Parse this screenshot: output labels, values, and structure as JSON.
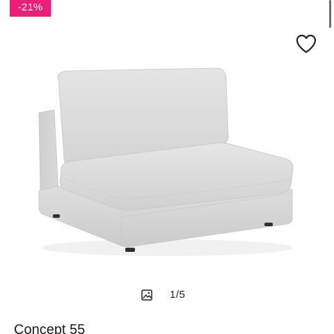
{
  "badge": {
    "discount_label": "-21%",
    "color": "#ec1e78"
  },
  "favorite": {
    "icon": "heart-outline-icon"
  },
  "product_image": {
    "subject": "light grey armless sofa module with back cushion",
    "upholstery_color": "#dcdcdc"
  },
  "gallery": {
    "icon": "image-gallery-icon",
    "counter": "1/5"
  },
  "product": {
    "title": "Concept 55"
  }
}
